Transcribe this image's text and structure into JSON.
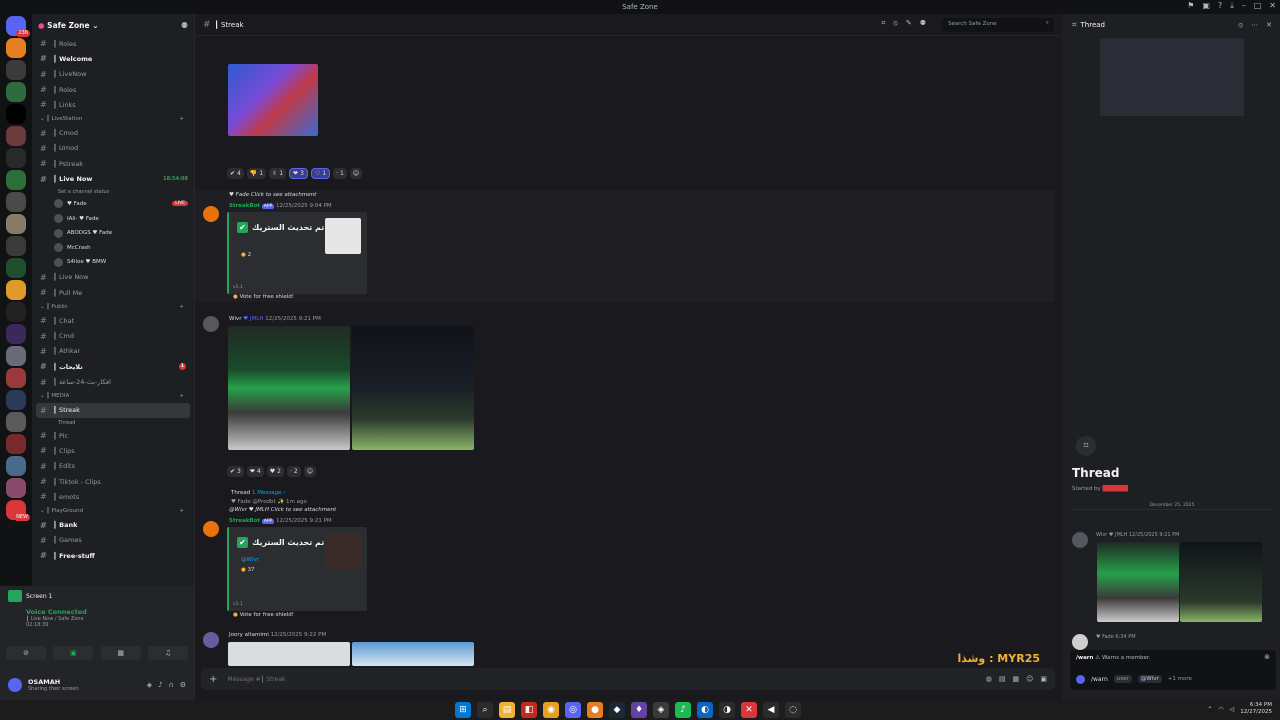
{
  "window": {
    "title": "Safe Zone"
  },
  "rail": {
    "servers": [
      {
        "badge": "236",
        "color": "#5865f2"
      },
      {
        "badge": "",
        "color": "#e67e22"
      },
      {
        "badge": "",
        "color": "#3b3b3b"
      },
      {
        "badge": "",
        "color": "#2d6b3c"
      },
      {
        "badge": "",
        "color": "#000000"
      },
      {
        "badge": "",
        "color": "#6b3a3a"
      },
      {
        "badge": "",
        "color": "#2a2a2a"
      },
      {
        "badge": "",
        "color": "#2e6e3a"
      },
      {
        "badge": "",
        "color": "#4a4a4a"
      },
      {
        "badge": "",
        "color": "#8a7a6a"
      },
      {
        "badge": "",
        "color": "#3a3a3a"
      },
      {
        "badge": "",
        "color": "#1e4e2e"
      },
      {
        "badge": "",
        "color": "#e09a2a"
      },
      {
        "badge": "",
        "color": "#222222"
      },
      {
        "badge": "",
        "color": "#3a2a5a"
      },
      {
        "badge": "",
        "color": "#6a6a7a"
      },
      {
        "badge": "",
        "color": "#9a3a3a"
      },
      {
        "badge": "",
        "color": "#2a3a5a"
      },
      {
        "badge": "",
        "color": "#5a5a5a"
      },
      {
        "badge": "",
        "color": "#7a2a2a"
      },
      {
        "badge": "",
        "color": "#4a6a8a"
      },
      {
        "badge": "",
        "color": "#8a4a6a"
      },
      {
        "badge": "NEW",
        "color": "#da373c"
      }
    ]
  },
  "sidebar": {
    "guild_name": "Safe Zone",
    "items": [
      {
        "kind": "chan",
        "icon": "#",
        "label": "┃ Roles",
        "style": ""
      },
      {
        "kind": "chan",
        "icon": "#",
        "label": "┃ Welcome",
        "style": "bold"
      },
      {
        "kind": "chan",
        "icon": "#",
        "label": "┃ LiveNow",
        "style": ""
      },
      {
        "kind": "chan",
        "icon": "#",
        "label": "┃ Roles",
        "style": ""
      },
      {
        "kind": "chan",
        "icon": "#",
        "label": "┃ Links",
        "style": ""
      },
      {
        "kind": "cat",
        "label": "┃ LiveStation"
      },
      {
        "kind": "chan",
        "icon": "#",
        "label": "┃ Cmod",
        "style": ""
      },
      {
        "kind": "chan",
        "icon": "#",
        "label": "┃ Umod",
        "style": ""
      },
      {
        "kind": "chan",
        "icon": "#",
        "label": "┃ Pstreak",
        "style": ""
      },
      {
        "kind": "chan",
        "icon": "#",
        "label": "┃ Live Now",
        "style": "bold",
        "extra": "timer",
        "extra_text": "18:54:08"
      },
      {
        "kind": "sub",
        "label": "Set a channel status"
      },
      {
        "kind": "vuser",
        "label": "♥ Fade",
        "live": "LIVE"
      },
      {
        "kind": "vuser",
        "label": "IAli- ♥ Fade"
      },
      {
        "kind": "vuser",
        "label": "ABODGS ♥ Fade"
      },
      {
        "kind": "vuser",
        "label": "McCrash"
      },
      {
        "kind": "vuser",
        "label": "S4lloe ♥ BMW"
      },
      {
        "kind": "chan",
        "icon": "#",
        "label": "┃ Live Now",
        "style": ""
      },
      {
        "kind": "chan",
        "icon": "#",
        "label": "┃ Pull Me",
        "style": ""
      },
      {
        "kind": "cat",
        "label": "┃ Public"
      },
      {
        "kind": "chan",
        "icon": "#",
        "label": "┃ Chat",
        "style": ""
      },
      {
        "kind": "chan",
        "icon": "#",
        "label": "┃ Cmd",
        "style": ""
      },
      {
        "kind": "chan",
        "icon": "#",
        "label": "┃ Athkar",
        "style": ""
      },
      {
        "kind": "chan",
        "icon": "#",
        "label": "┃ تلايحات",
        "style": "bold",
        "extra": "dot",
        "extra_text": "1"
      },
      {
        "kind": "chan",
        "icon": "#",
        "label": "┃ افكار-بث-24-ساعة",
        "style": ""
      },
      {
        "kind": "cat",
        "label": "┃ MEDIA"
      },
      {
        "kind": "chan",
        "icon": "#",
        "label": "┃ Streak",
        "style": "active"
      },
      {
        "kind": "sub",
        "label": "Thread"
      },
      {
        "kind": "chan",
        "icon": "#",
        "label": "┃ Pic",
        "style": ""
      },
      {
        "kind": "chan",
        "icon": "#",
        "label": "┃ Clips",
        "style": ""
      },
      {
        "kind": "chan",
        "icon": "#",
        "label": "┃ Edits",
        "style": ""
      },
      {
        "kind": "chan",
        "icon": "#",
        "label": "┃ Tiktok - Clips",
        "style": ""
      },
      {
        "kind": "chan",
        "icon": "#",
        "label": "┃ emots",
        "style": ""
      },
      {
        "kind": "cat",
        "label": "┃ PlayGround"
      },
      {
        "kind": "chan",
        "icon": "#",
        "label": "┃ Bank",
        "style": "bold"
      },
      {
        "kind": "chan",
        "icon": "#",
        "label": "┃ Games",
        "style": ""
      },
      {
        "kind": "chan",
        "icon": "#",
        "label": "┃ Free-stuff",
        "style": "bold"
      }
    ]
  },
  "panel": {
    "screen_label": "Screen 1",
    "voice_connected": "Voice Connected",
    "voice_channel": "┃ Live Now / Safe Zone",
    "voice_timer": "02:18:39",
    "user_name": "OSAMAH",
    "user_status": "Sharing their screen"
  },
  "chat": {
    "channel_name": "┃ Streak",
    "search_placeholder": "Search Safe Zone",
    "reactions1": [
      {
        "e": "✔",
        "n": "4",
        "on": false
      },
      {
        "e": "👎",
        "n": "1",
        "on": false
      },
      {
        "e": "✌",
        "n": "1",
        "on": false
      },
      {
        "e": "❤",
        "n": "3",
        "on": true
      },
      {
        "e": "♡",
        "n": "1",
        "on": true
      },
      {
        "e": "·",
        "n": "1",
        "on": false
      }
    ],
    "msg1": {
      "reply": "♥ Fade  Click to see attachment",
      "author": "StreakBot",
      "app_tag": "APP",
      "time": "12/25/2025 9:04 PM",
      "embed_title": "تم تحديث الستريك •",
      "embed_count": "2",
      "embed_foot": "v1.1",
      "vote": "Vote for free shield!"
    },
    "msg2": {
      "author": "Wlvr",
      "tag": "♥ JMLH",
      "time": "12/25/2025 9:21 PM",
      "thread_label": "Thread",
      "thread_count": "1 Message ›",
      "thread_sub": "♥ Fade  @Prodbt ✨   1m ago"
    },
    "reactions2": [
      {
        "e": "✔",
        "n": "3",
        "on": false
      },
      {
        "e": "❤",
        "n": "4",
        "on": false
      },
      {
        "e": "♥",
        "n": "2",
        "on": false
      },
      {
        "e": "·",
        "n": "2",
        "on": false
      }
    ],
    "msg3": {
      "reply": "@Wlvr ♥ JMLH  Click to see attachment",
      "author": "StreakBot",
      "app_tag": "APP",
      "time": "12/25/2025 9:21 PM",
      "embed_title": "تم تحديث الستريك •",
      "embed_mention": "@Wlvr",
      "embed_count": "37",
      "embed_foot": "v1.1",
      "vote": "Vote for free shield!"
    },
    "msg4": {
      "author": "Joory altamimi",
      "time": "12/25/2025 9:22 PM"
    },
    "composer_placeholder": "Message #┃ Streak",
    "overlay_text": "وشذا : MYR25"
  },
  "thread": {
    "header": "Thread",
    "title": "Thread",
    "started_by": "Started by",
    "date_divider": "December 25, 2025",
    "msg_author": "Wlvr ♥ JMLH",
    "msg_time": "12/25/2025 9:21 PM",
    "msg2_meta": "♥ Fade   6:34 PM",
    "cmd_name": "/warn",
    "cmd_desc": "⚠ Warns a member.",
    "cmd_input": "/warn",
    "cmd_user": "user",
    "cmd_mention": "@Wlvr",
    "cmd_more": "+1 more"
  },
  "taskbar": {
    "time": "6:34 PM",
    "date": "12/27/2025",
    "apps": [
      {
        "g": "⊞",
        "c": "#0078d4"
      },
      {
        "g": "⌕",
        "c": "#2b2b2b"
      },
      {
        "g": "▤",
        "c": "#f0b232"
      },
      {
        "g": "◧",
        "c": "#c42b1c"
      },
      {
        "g": "◉",
        "c": "#e8a020"
      },
      {
        "g": "◎",
        "c": "#5865f2"
      },
      {
        "g": "●",
        "c": "#e67e22"
      },
      {
        "g": "◆",
        "c": "#1b2838"
      },
      {
        "g": "♦",
        "c": "#6441a5"
      },
      {
        "g": "◈",
        "c": "#3a3a3a"
      },
      {
        "g": "♪",
        "c": "#1db954"
      },
      {
        "g": "◐",
        "c": "#0a66c2"
      },
      {
        "g": "◑",
        "c": "#2b2b2b"
      },
      {
        "g": "✕",
        "c": "#da373c"
      },
      {
        "g": "◀",
        "c": "#2b2b2b"
      },
      {
        "g": "◌",
        "c": "#2b2b2b"
      }
    ]
  }
}
